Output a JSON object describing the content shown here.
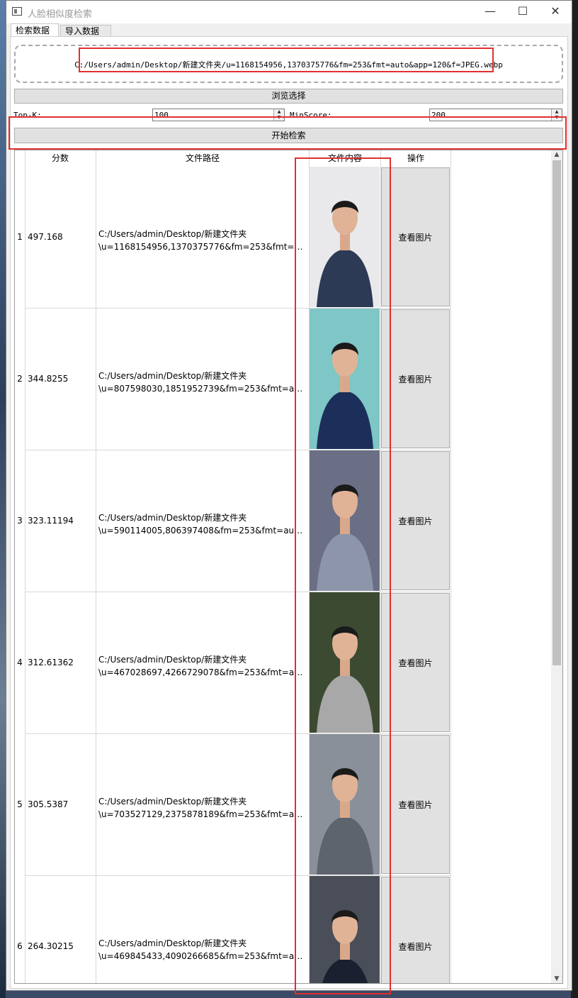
{
  "window": {
    "title": "人脸相似度检索",
    "minimize": "—",
    "maximize": "☐",
    "close": "✕"
  },
  "tabs": [
    {
      "label": "检索数据"
    },
    {
      "label": "导入数据"
    }
  ],
  "drop_zone": {
    "path": "C:/Users/admin/Desktop/新建文件夹/u=1168154956,1370375776&fm=253&fmt=auto&app=120&f=JPEG.webp"
  },
  "browse_button": "浏览选择",
  "topk": {
    "label": "Top-K:",
    "value": "100"
  },
  "minscore": {
    "label": "MinScore:",
    "value": "200"
  },
  "search_button": "开始检索",
  "table": {
    "headers": [
      "分数",
      "文件路径",
      "文件内容",
      "操作"
    ],
    "rows": [
      {
        "index": "1",
        "score": "497.168",
        "path_line1": "C:/Users/admin/Desktop/新建文件夹",
        "path_line2": "\\u=1168154956,1370375776&fm=253&fmt=aut...",
        "action": "查看图片",
        "bg": "#e9e9ec",
        "shirt": "#2c3a55"
      },
      {
        "index": "2",
        "score": "344.8255",
        "path_line1": "C:/Users/admin/Desktop/新建文件夹",
        "path_line2": "\\u=807598030,1851952739&fm=253&fmt=auto...",
        "action": "查看图片",
        "bg": "#7fc6c6",
        "shirt": "#1c2f5a"
      },
      {
        "index": "3",
        "score": "323.11194",
        "path_line1": "C:/Users/admin/Desktop/新建文件夹",
        "path_line2": "\\u=590114005,806397408&fm=253&fmt=auto&...",
        "action": "查看图片",
        "bg": "#6a6f86",
        "shirt": "#8d95aa"
      },
      {
        "index": "4",
        "score": "312.61362",
        "path_line1": "C:/Users/admin/Desktop/新建文件夹",
        "path_line2": "\\u=467028697,4266729078&fm=253&fmt=auto...",
        "action": "查看图片",
        "bg": "#3d4a32",
        "shirt": "#a8a8a8"
      },
      {
        "index": "5",
        "score": "305.5387",
        "path_line1": "C:/Users/admin/Desktop/新建文件夹",
        "path_line2": "\\u=703527129,2375878189&fm=253&fmt=auto...",
        "action": "查看图片",
        "bg": "#8a9099",
        "shirt": "#5d646d"
      },
      {
        "index": "6",
        "score": "264.30215",
        "path_line1": "C:/Users/admin/Desktop/新建文件夹",
        "path_line2": "\\u=469845433,4090266685&fm=253&fmt=auto...",
        "action": "查看图片",
        "bg": "#4a4e58",
        "shirt": "#1a2030"
      }
    ]
  }
}
